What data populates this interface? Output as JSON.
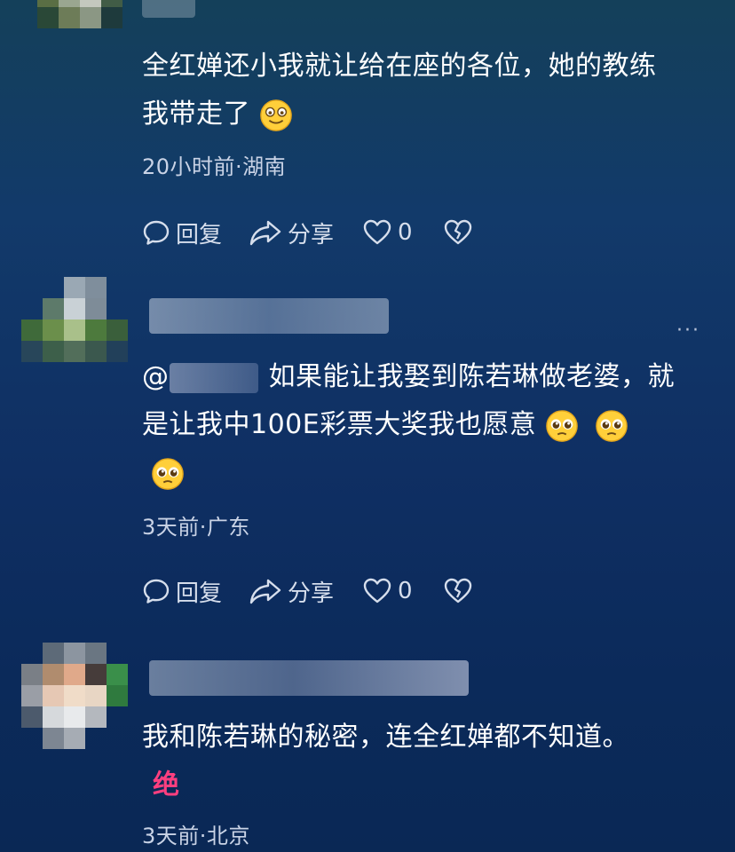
{
  "comments": [
    {
      "text_line1": "全红婵还小我就让给在座的各位，她的教练",
      "text_line2": "我带走了",
      "emoji": "smile-emoji",
      "meta": "20小时前·湖南",
      "reply_label": "回复",
      "share_label": "分享",
      "like_count": "0"
    },
    {
      "mention": "@",
      "text_line1": "如果能让我娶到陈若琳做老婆，就",
      "text_line2": "是让我中100E彩票大奖我也愿意",
      "emoji": "pleading-face-emoji",
      "meta": "3天前·广东",
      "reply_label": "回复",
      "share_label": "分享",
      "like_count": "0",
      "more_label": "···"
    },
    {
      "text_line1": "我和陈若琳的秘密，连全红婵都不知道。",
      "badge": "绝",
      "meta": "3天前·北京"
    }
  ],
  "colors": {
    "background_top": "#14405a",
    "background_bottom": "#0a2855",
    "meta_text": "#c9d3e6",
    "badge": "#ff3f7f"
  }
}
